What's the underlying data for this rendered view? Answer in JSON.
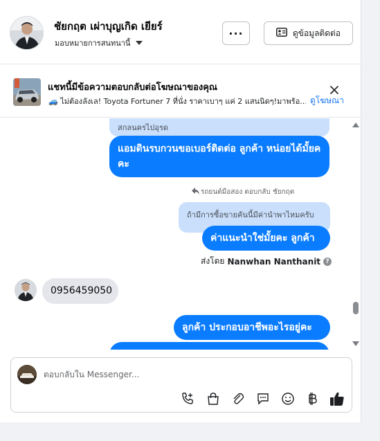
{
  "header": {
    "contact_name": "ชัยกฤต เผ่าบุญเกิด เยียร์",
    "assign_label": "มอบหมายการสนทนานี้",
    "more_label": "···",
    "contact_info_label": "ดูข้อมูลติดต่อ"
  },
  "ad_banner": {
    "title": "แชทนี้มีข้อความตอบกลับต่อโฆษณาของคุณ",
    "subtitle": "🚙 ไม่ต้องลังเล! Toyota Fortuner 7 ที่นั่ง ราคาเบาๆ แค่ 2 แสนนิดๆ!มาพร้อ...",
    "link_label": "ดูโฆษณา"
  },
  "messages": {
    "quote_top": "สกลนครไปอุรด",
    "outgoing_1": "แอมดินรบกวนขอเบอร์ติดต่อ ลูกค้า หน่อยได้มั้ยคคะ",
    "reply_meta": "รถยนต์มือสอง ตอบกลับ ชัยกฤต",
    "quote_2": "ถ้ามีการซื้อขายคันนี้มีค่านำพาไหมครับ",
    "outgoing_2": "ค่าแนะนำใช่มั้ยคะ  ลูกค้า",
    "sent_by_prefix": "ส่งโดย",
    "sent_by_name": "Nanwhan Nanthanit",
    "info_icon": "?",
    "incoming_1": "0956459050",
    "outgoing_3": "ลูกค้า ประกอบอาชีพอะไรอยู่คะ"
  },
  "composer": {
    "placeholder": "ตอบกลับใน Messenger...",
    "tools": [
      "phone-plus-icon",
      "shopping-bag-icon",
      "paperclip-icon",
      "quick-reply-icon",
      "emoji-icon",
      "baht-icon",
      "thumbs-up-icon"
    ]
  },
  "colors": {
    "accent": "#0a7cff",
    "link": "#1877f2",
    "quote_bg": "#c9dffc",
    "incoming_bg": "#e4e6eb"
  }
}
